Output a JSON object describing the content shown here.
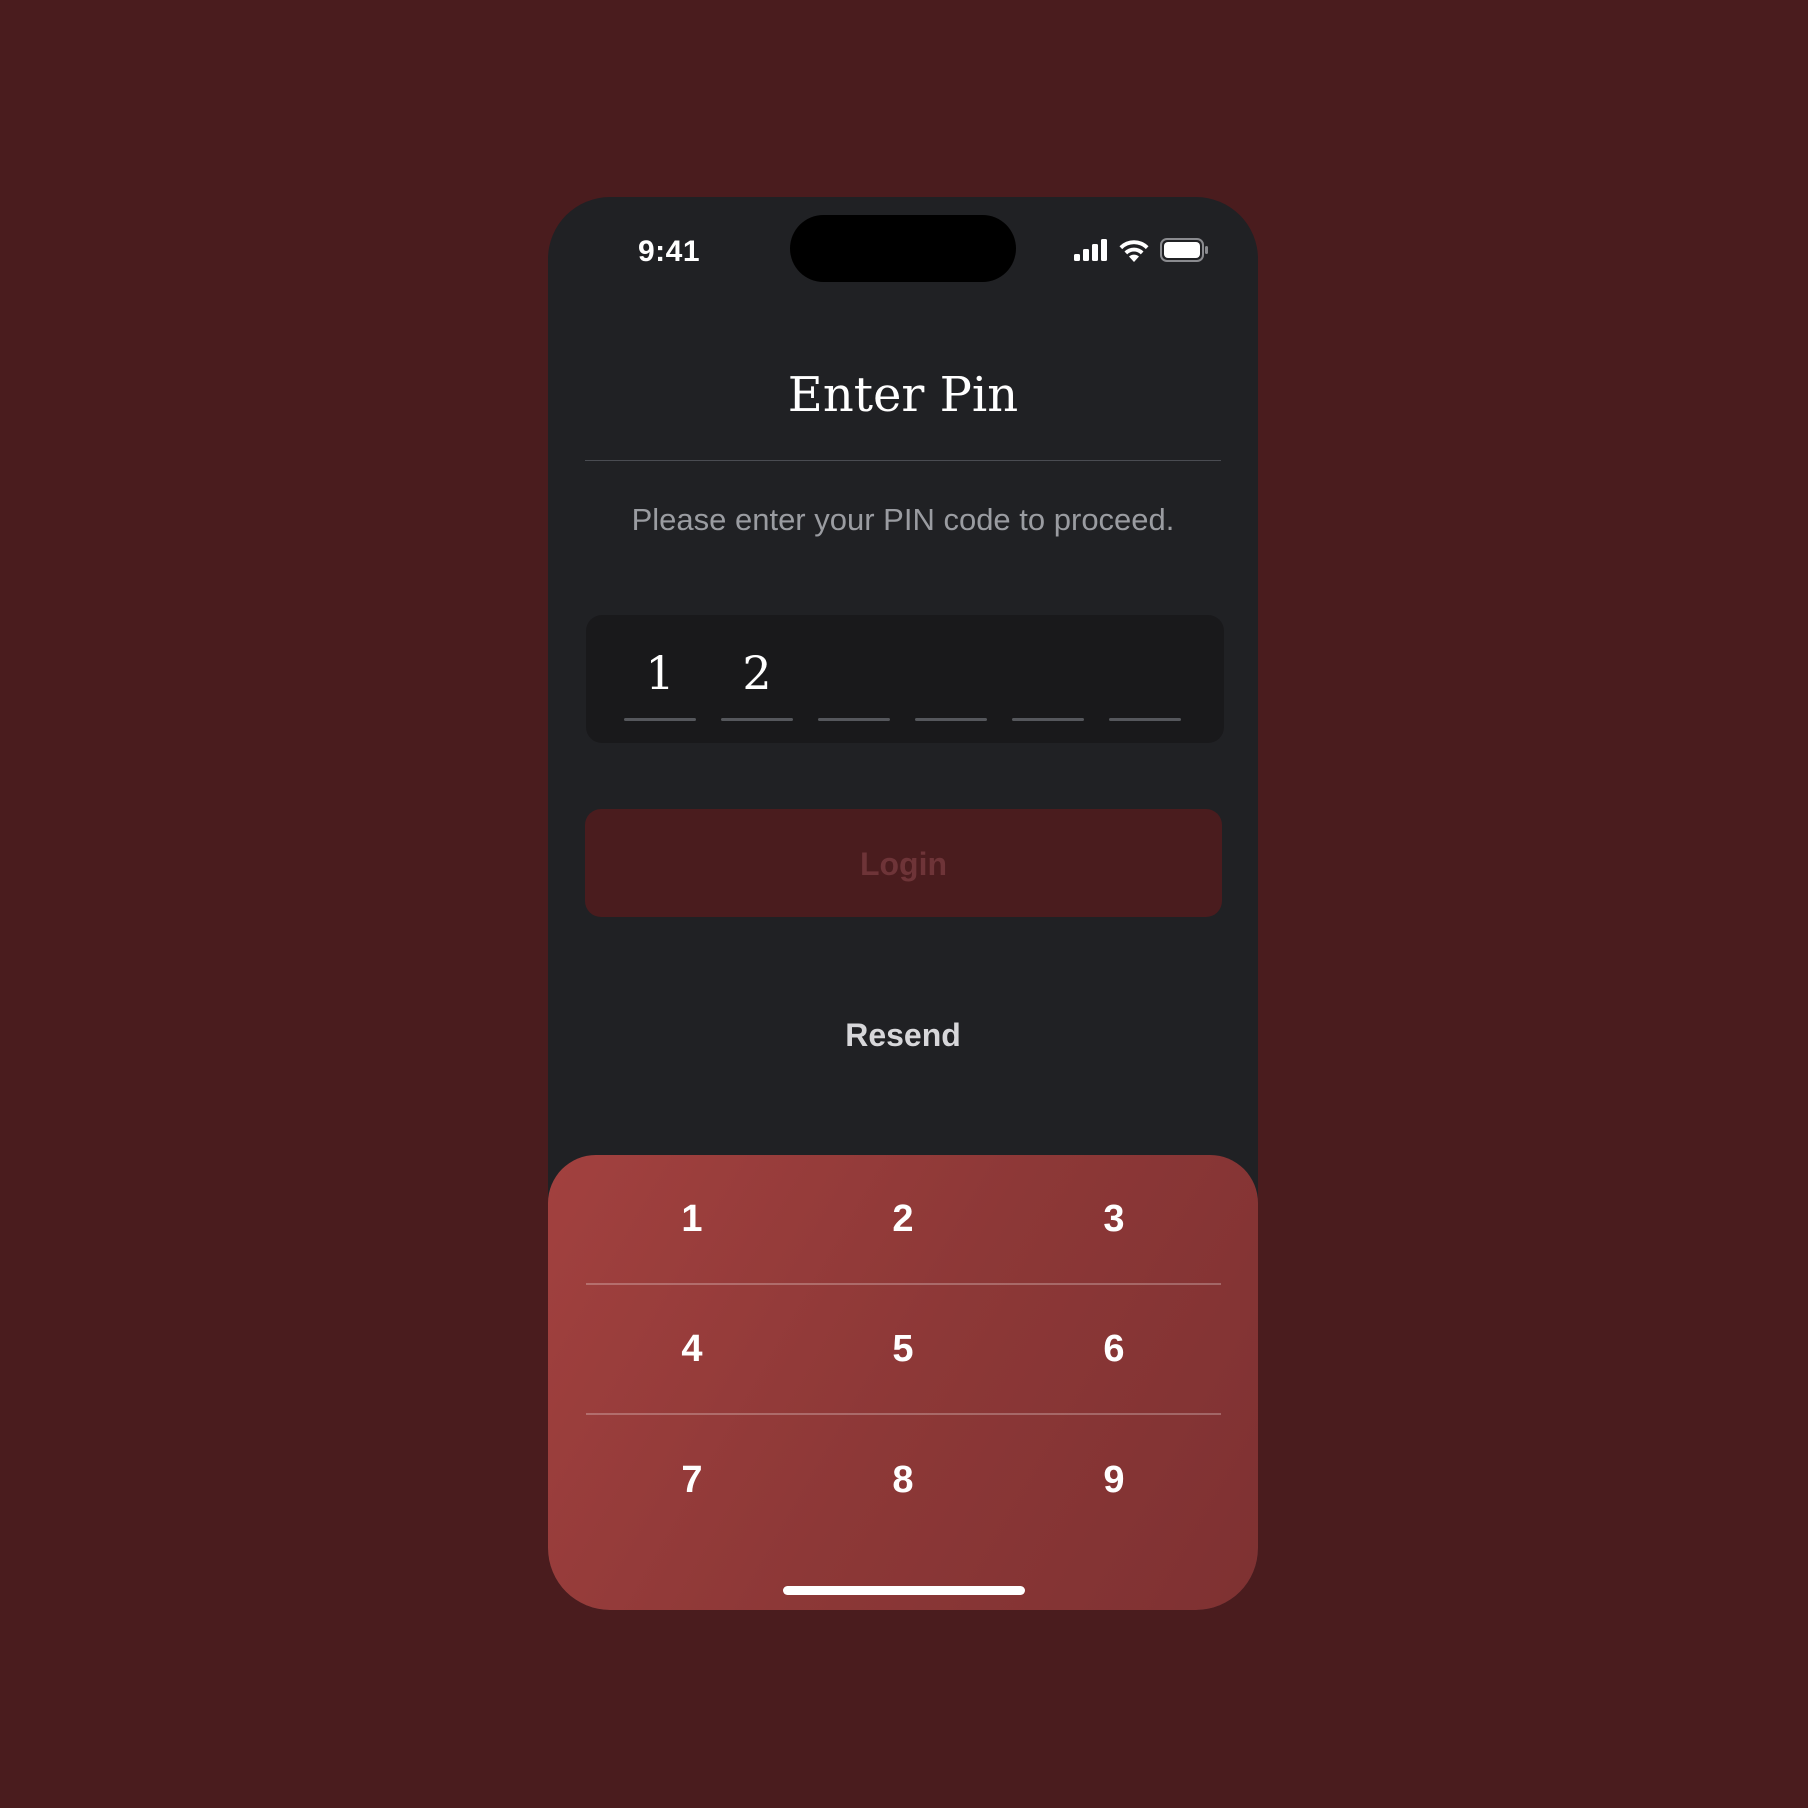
{
  "status_bar": {
    "time": "9:41",
    "icons": [
      "signal-icon",
      "wifi-icon",
      "battery-icon"
    ]
  },
  "screen": {
    "title": "Enter Pin",
    "subtitle": "Please enter your PIN code to proceed."
  },
  "pin": {
    "length": 6,
    "digits": [
      "1",
      "2",
      "",
      "",
      "",
      ""
    ]
  },
  "actions": {
    "login_label": "Login",
    "login_enabled": false,
    "resend_label": "Resend"
  },
  "keypad": {
    "keys": [
      "1",
      "2",
      "3",
      "4",
      "5",
      "6",
      "7",
      "8",
      "9"
    ]
  },
  "colors": {
    "background": "#4a1c1e",
    "phone_surface": "#202124",
    "pin_box": "#19191b",
    "keypad_accent": "#943b3a",
    "login_disabled_text": "#6e3438"
  }
}
